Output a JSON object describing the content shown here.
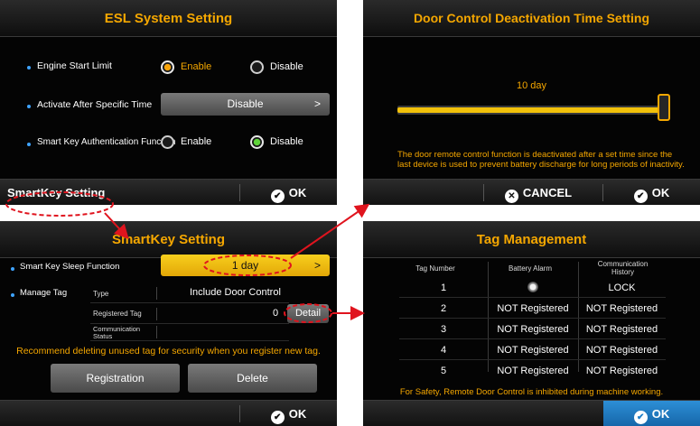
{
  "esl": {
    "title": "ESL System Setting",
    "engine_start_limit": {
      "label": "Engine Start Limit",
      "enable": "Enable",
      "disable": "Disable"
    },
    "activate_after": {
      "label": "Activate After Specific Time",
      "value": "Disable",
      "chevron": ">"
    },
    "smart_key_auth": {
      "label": "Smart Key Authentication Function",
      "enable": "Enable",
      "disable": "Disable"
    },
    "smartkey_button": "SmartKey Setting",
    "ok": "OK"
  },
  "door": {
    "title": "Door Control Deactivation Time Setting",
    "slider_value_text": "10 day",
    "slider_fraction": 1.0,
    "note": "The door remote control function is deactivated after a set time since the last device is used to prevent battery discharge for long periods of inactivity.",
    "cancel": "CANCEL",
    "ok": "OK"
  },
  "smartkey": {
    "title": "SmartKey Setting",
    "sleep_label": "Smart Key Sleep Function",
    "sleep_value": "1 day",
    "chevron": ">",
    "manage_tag_label": "Manage Tag",
    "type_label": "Type",
    "type_value": "Include Door Control",
    "registered_label": "Registered Tag",
    "registered_value": "0",
    "detail_button": "Detail",
    "comm_label_1": "Communication",
    "comm_label_2": "Status",
    "recommend": "Recommend deleting unused tag for security when you register new tag.",
    "registration": "Registration",
    "delete": "Delete",
    "ok": "OK"
  },
  "tag": {
    "title": "Tag Management",
    "headers": {
      "tag_number": "Tag Number",
      "battery_alarm": "Battery Alarm",
      "comm_history_1": "Communication",
      "comm_history_2": "History"
    },
    "rows": [
      {
        "num": "1",
        "battery": "",
        "history": "LOCK"
      },
      {
        "num": "2",
        "battery": "NOT Registered",
        "history": "NOT Registered"
      },
      {
        "num": "3",
        "battery": "NOT Registered",
        "history": "NOT Registered"
      },
      {
        "num": "4",
        "battery": "NOT Registered",
        "history": "NOT Registered"
      },
      {
        "num": "5",
        "battery": "NOT Registered",
        "history": "NOT Registered"
      }
    ],
    "safety": "For Safety, Remote Door Control is inhibited during machine working.",
    "ok": "OK"
  },
  "colors": {
    "accent_orange": "#f5a700",
    "highlight_yellow": "#f2c10a",
    "annotation_red": "#e0141e",
    "ok_blue": "#1f7fc8",
    "bullet_blue": "#3fa4ff"
  },
  "icons": {
    "check": "check-circle-icon",
    "cancel": "x-circle-icon",
    "chevron": "chevron-right-icon",
    "radio_dot": "radio-indicator-icon"
  }
}
